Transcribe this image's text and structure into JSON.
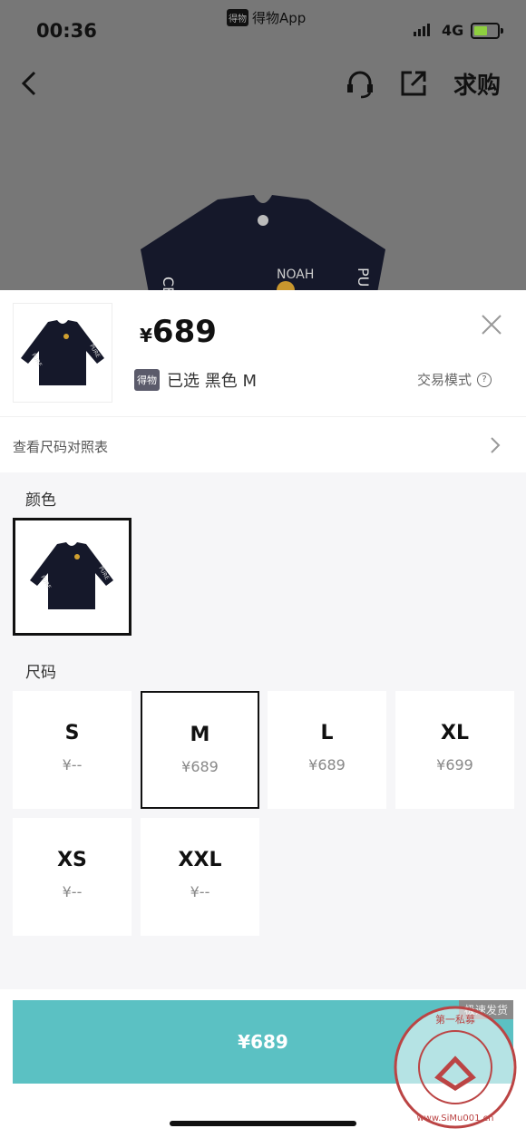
{
  "status_bar": {
    "time": "00:36",
    "app_label": "得物App",
    "app_badge": "得物",
    "network": "4G"
  },
  "nav": {
    "seek_label": "求购"
  },
  "sheet": {
    "price_currency": "¥",
    "price_value": "689",
    "selected_badge": "得物",
    "selected_text": "已选 黑色 M",
    "trade_mode_label": "交易模式",
    "size_chart_link": "查看尺码对照表"
  },
  "color_section": {
    "label": "颜色"
  },
  "size_section": {
    "label": "尺码",
    "sizes": [
      {
        "size": "S",
        "price": "¥--",
        "selected": false
      },
      {
        "size": "M",
        "price": "¥689",
        "selected": true
      },
      {
        "size": "L",
        "price": "¥689",
        "selected": false
      },
      {
        "size": "XL",
        "price": "¥699",
        "selected": false
      },
      {
        "size": "XS",
        "price": "¥--",
        "selected": false
      },
      {
        "size": "XXL",
        "price": "¥--",
        "selected": false
      }
    ]
  },
  "buy_button": {
    "label": "¥689",
    "ship_tag": "极速发货"
  },
  "watermark": {
    "text": "第一私募 www.SiMu001.cn"
  },
  "colors": {
    "accent": "#5bc1c3",
    "dim_overlay": "#777777"
  }
}
